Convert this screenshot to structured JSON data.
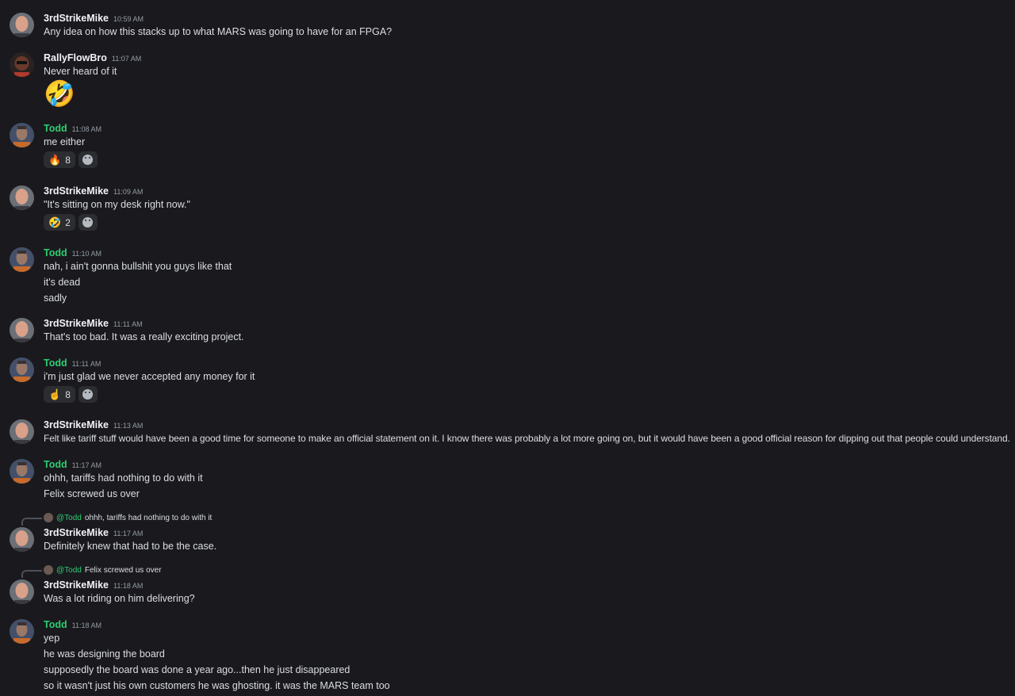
{
  "messages": [
    {
      "user": "3rdStrikeMike",
      "time": "10:59 AM",
      "lines": [
        "Any idea on how this stacks up to what MARS was going to have for an FPGA?"
      ]
    },
    {
      "user": "RallyFlowBro",
      "time": "11:07 AM",
      "lines": [
        "Never heard of it"
      ],
      "big_emoji": "🤣"
    },
    {
      "user": "Todd",
      "time": "11:08 AM",
      "lines": [
        "me either"
      ],
      "reactions": [
        {
          "emoji": "🔥",
          "count": "8"
        }
      ]
    },
    {
      "user": "3rdStrikeMike",
      "time": "11:09 AM",
      "lines": [
        "\"It's sitting on my desk right now.\""
      ],
      "reactions": [
        {
          "emoji": "🤣",
          "count": "2"
        }
      ]
    },
    {
      "user": "Todd",
      "time": "11:10 AM",
      "lines": [
        "nah, i ain't gonna bullshit you guys like that",
        "it's dead",
        "sadly"
      ]
    },
    {
      "user": "3rdStrikeMike",
      "time": "11:11 AM",
      "lines": [
        "That's too bad.  It was a really exciting project."
      ]
    },
    {
      "user": "Todd",
      "time": "11:11 AM",
      "lines": [
        "i'm just glad we never accepted any money for it"
      ],
      "reactions": [
        {
          "emoji": "☝️",
          "count": "8"
        }
      ]
    },
    {
      "user": "3rdStrikeMike",
      "time": "11:13 AM",
      "lines": [
        "Felt like tariff stuff would have been a good time for someone to make an official statement on it.  I know there was probably a lot more going on, but it would have been a good official reason for dipping out that people could understand."
      ]
    },
    {
      "user": "Todd",
      "time": "11:17 AM",
      "lines": [
        "ohhh, tariffs had nothing to do with it",
        "Felix screwed us over"
      ]
    },
    {
      "user": "3rdStrikeMike",
      "time": "11:17 AM",
      "lines": [
        "Definitely knew that had to be the case."
      ],
      "reply": {
        "mention": "@Todd",
        "text": "ohhh, tariffs had nothing to do with it"
      }
    },
    {
      "user": "3rdStrikeMike",
      "time": "11:18 AM",
      "lines": [
        "Was a lot riding on him delivering?"
      ],
      "reply": {
        "mention": "@Todd",
        "text": "Felix screwed us over"
      }
    },
    {
      "user": "Todd",
      "time": "11:18 AM",
      "lines": [
        "yep",
        "he was designing the board",
        "supposedly the board was done a year ago...then he just disappeared",
        "so it wasn't just his own customers he was ghosting. it was the MARS team too"
      ]
    }
  ],
  "colors": {
    "background": "#1a1a1e",
    "todd": "#2ecc71",
    "timestamp": "#949ba4",
    "reaction_bg": "#2b2d31"
  },
  "icons": {
    "add_reaction": "smile-plus-icon",
    "reply_spine": "reply-connector"
  }
}
